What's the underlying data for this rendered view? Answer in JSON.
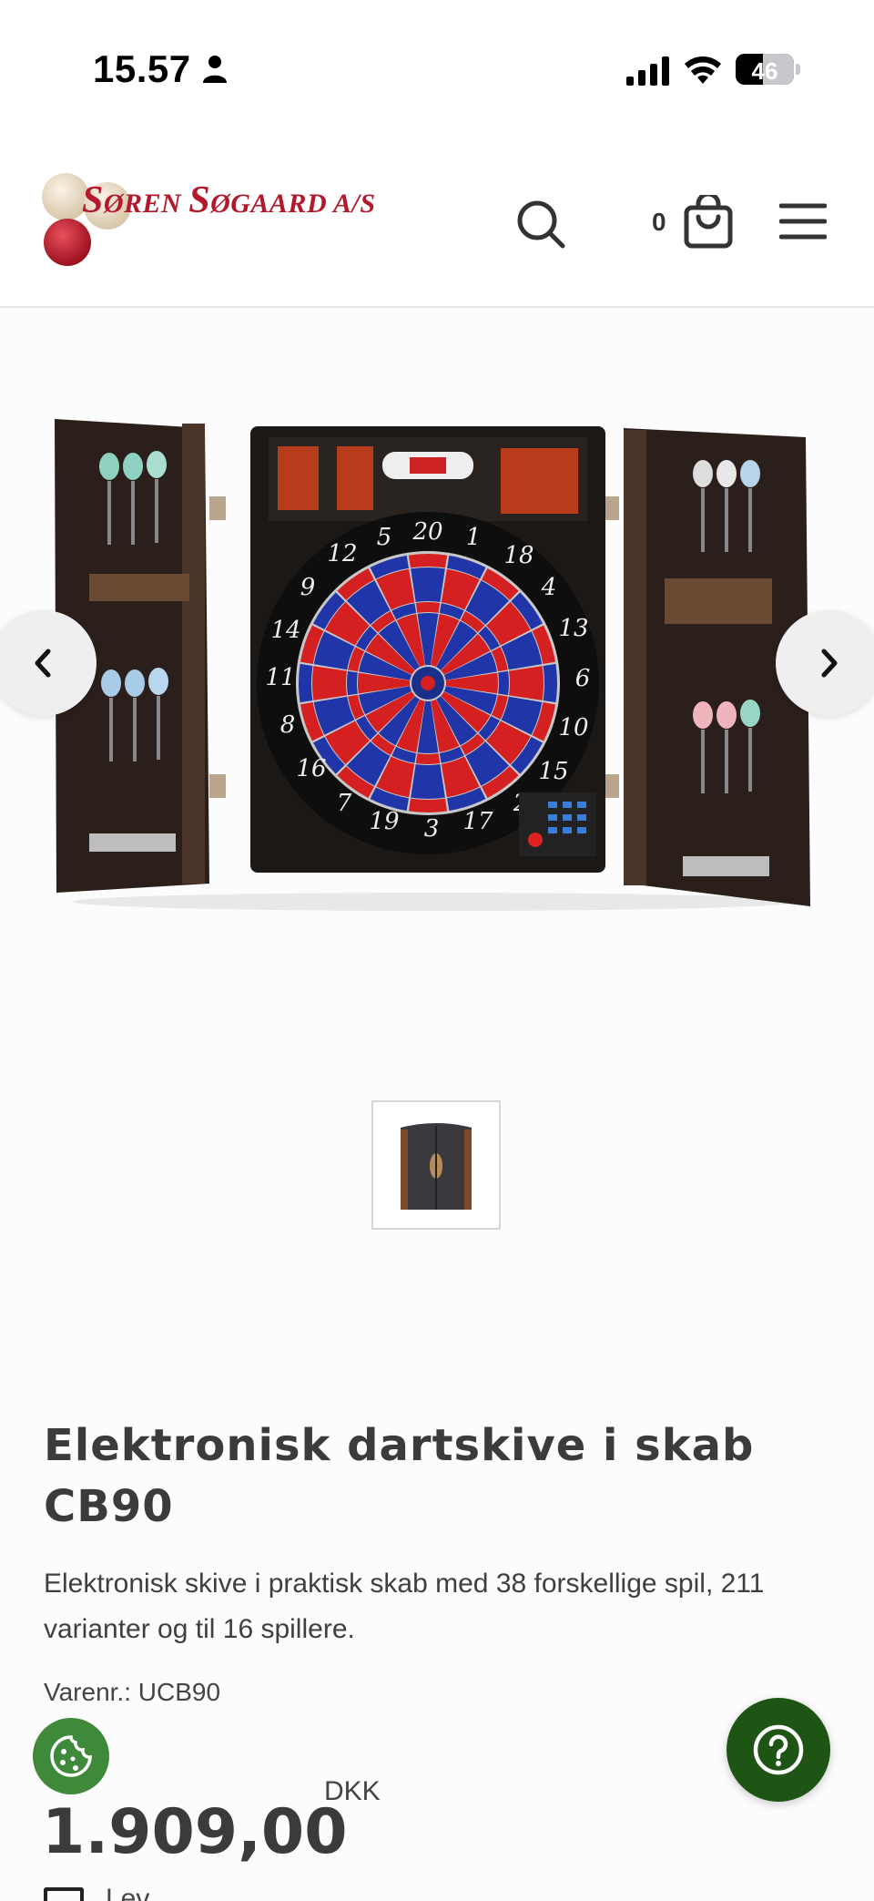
{
  "status_bar": {
    "time": "15.57",
    "battery_level": "46",
    "icons": [
      "person-icon",
      "cellular-signal-icon",
      "wifi-icon",
      "battery-icon"
    ]
  },
  "header": {
    "logo_text_1": "S",
    "logo_text_2": "ØREN ",
    "logo_text_3": "S",
    "logo_text_4": "ØGAARD A/S",
    "cart_count": "0",
    "icons": [
      "search-icon",
      "cart-icon",
      "menu-icon"
    ]
  },
  "gallery": {
    "icons": [
      "chevron-left-icon",
      "chevron-right-icon"
    ]
  },
  "product": {
    "title": "Elektronisk dartskive i skab CB90",
    "description": "Elektronisk skive i praktisk skab med 38 forskellige spil, 211 varianter og til 16 spillere.",
    "sku": "Varenr.: UCB90",
    "price": "1.909,00",
    "currency": "DKK",
    "shipping_partial": "Lev..."
  },
  "floating": {
    "icons": [
      "cookie-icon",
      "help-icon"
    ]
  },
  "colors": {
    "brand_red": "#b4182a",
    "help_green": "#1f5514",
    "cookie_green": "#3f8a3a"
  }
}
